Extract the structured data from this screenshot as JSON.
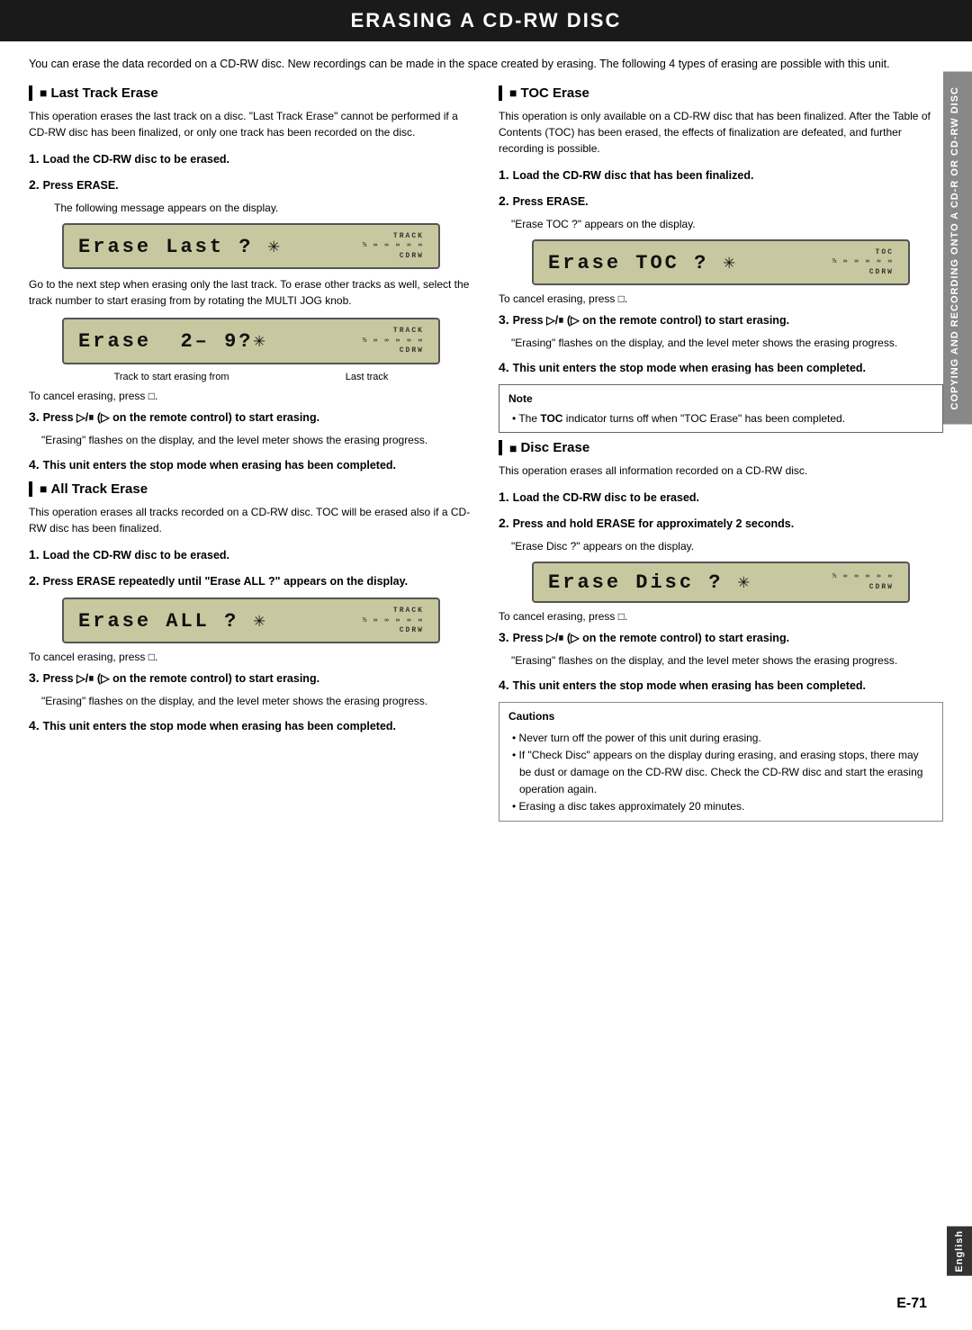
{
  "page": {
    "title": "ERASING A CD-RW DISC",
    "page_number": "E-71",
    "side_tab": "COPYING AND RECORDING ONTO A CD-R OR CD-RW DISC",
    "english_tab": "English"
  },
  "intro": "You can erase the data recorded on a CD-RW disc. New recordings can be made in the space created by erasing. The following 4 types of erasing are possible with this unit.",
  "sections": {
    "last_track_erase": {
      "title": "Last Track Erase",
      "desc": "This operation erases the last track on a disc. \"Last Track Erase\" cannot be performed if a CD-RW disc has been finalized, or only one track has been recorded on the disc.",
      "steps": [
        {
          "num": "1",
          "text": "Load the CD-RW disc to be erased."
        },
        {
          "num": "2",
          "text": "Press ERASE.",
          "sub": "The following message appears on the display."
        }
      ],
      "lcd1": {
        "text": "Erase Last ?",
        "indicator_top": "TRACK",
        "indicator_bottom": "CDRW"
      },
      "mid_note": "Go to the next step when erasing only the last track. To erase other tracks as well, select the track number to start erasing from by rotating the MULTI JOG knob.",
      "lcd2": {
        "text": "Erase  2– 9?",
        "indicator_top": "TRACK",
        "indicator_bottom": "CDRW"
      },
      "diagram": {
        "left": "Track to start erasing from",
        "right": "Last track"
      },
      "cancel_note": "To cancel erasing, press □.",
      "steps2": [
        {
          "num": "3",
          "text": "Press ▷/⏸ (▷ on the remote control) to start erasing.",
          "sub": "\"Erasing\" flashes on the display, and the level meter shows the erasing progress."
        },
        {
          "num": "4",
          "text": "This unit enters the stop mode when erasing has been completed.",
          "bold": true
        }
      ]
    },
    "all_track_erase": {
      "title": "All Track Erase",
      "desc": "This operation erases all tracks recorded on a CD-RW disc. TOC will be erased also if a CD-RW disc has been finalized.",
      "steps": [
        {
          "num": "1",
          "text": "Load the CD-RW disc to be erased."
        },
        {
          "num": "2",
          "text": "Press ERASE repeatedly until \"Erase ALL ?\" appears on the display."
        }
      ],
      "lcd": {
        "text": "Erase ALL ?",
        "indicator_top": "TRACK",
        "indicator_bottom": "CDRW"
      },
      "cancel_note": "To cancel erasing, press □.",
      "steps2": [
        {
          "num": "3",
          "text": "Press ▷/⏸ (▷ on the remote control) to start erasing.",
          "sub": "\"Erasing\" flashes on the display, and the level meter shows the erasing progress."
        },
        {
          "num": "4",
          "text": "This unit enters the stop mode when erasing has been completed.",
          "bold": true
        }
      ]
    },
    "toc_erase": {
      "title": "TOC Erase",
      "desc": "This operation is only available on a CD-RW disc that has been finalized. After the Table of Contents (TOC) has been erased, the effects of finalization are defeated, and further recording is possible.",
      "steps": [
        {
          "num": "1",
          "text": "Load the CD-RW disc that has been finalized."
        },
        {
          "num": "2",
          "text": "Press ERASE.",
          "sub": "\"Erase TOC ?\" appears on the display."
        }
      ],
      "lcd": {
        "text": "Erase TOC ?",
        "indicator_top": "TOC",
        "indicator_bottom": "CDRW"
      },
      "cancel_note": "To cancel erasing, press □.",
      "steps2": [
        {
          "num": "3",
          "text": "Press ▷/⏸ (▷ on the remote control) to start erasing.",
          "sub": "\"Erasing\" flashes on the display, and the level meter shows the erasing progress."
        },
        {
          "num": "4",
          "text": "This unit enters the stop mode when erasing has been completed.",
          "bold": true
        }
      ],
      "note": {
        "title": "Note",
        "text": "The TOC indicator turns off when \"TOC Erase\" has been completed."
      }
    },
    "disc_erase": {
      "title": "Disc Erase",
      "desc": "This operation erases all information recorded on a CD-RW disc.",
      "steps": [
        {
          "num": "1",
          "text": "Load the CD-RW disc to be erased."
        },
        {
          "num": "2",
          "text": "Press and hold ERASE for approximately 2 seconds.",
          "sub": "\"Erase Disc ?\" appears on the display."
        }
      ],
      "lcd": {
        "text": "Erase Disc ?",
        "indicator_bottom": "CDRW"
      },
      "cancel_note": "To cancel erasing, press □.",
      "steps2": [
        {
          "num": "3",
          "text": "Press ▷/⏸ (▷ on the remote control) to start erasing.",
          "sub": "\"Erasing\" flashes on the display, and the level meter shows the erasing progress."
        },
        {
          "num": "4",
          "text": "This unit enters the stop mode when erasing has been completed.",
          "bold": true
        }
      ],
      "cautions": {
        "title": "Cautions",
        "items": [
          "Never turn off the power of this unit during erasing.",
          "If \"Check Disc\" appears on the display during erasing, and erasing stops, there may be dust or damage on the CD-RW disc. Check the CD-RW disc and start the erasing operation again.",
          "Erasing a disc takes approximately 20 minutes."
        ]
      }
    }
  }
}
